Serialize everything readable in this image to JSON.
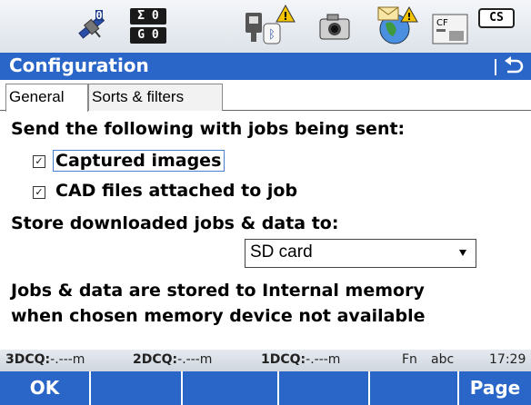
{
  "status_bar": {
    "satellite_count": "0",
    "sigma_value": "0",
    "g_value": "0",
    "sigma_label": "Σ",
    "g_label": "G",
    "cf_label": "CF",
    "cs_label": "CS",
    "icons": [
      "satellite-icon",
      "sensor-bluetooth-warning-icon",
      "camera-icon",
      "globe-mail-warning-icon",
      "cf-card-icon",
      "cs-controller-icon"
    ]
  },
  "title_bar": {
    "title": "Configuration",
    "color": "#2a65c8"
  },
  "tabs": [
    {
      "label": "General",
      "active": true
    },
    {
      "label": "Sorts & filters",
      "active": false
    }
  ],
  "content": {
    "send_heading": "Send the following with jobs being sent:",
    "checkboxes": [
      {
        "label": "Captured images",
        "checked": true,
        "focused": true
      },
      {
        "label": "CAD files attached to job",
        "checked": true,
        "focused": false
      }
    ],
    "store_heading": "Store downloaded jobs & data to:",
    "storage_select": {
      "value": "SD card"
    },
    "note_line1": "Jobs & data are stored to Internal memory",
    "note_line2": "when chosen memory device not available"
  },
  "info_bar": {
    "dcq3_label": "3DCQ:",
    "dcq3_value": "-.---m",
    "dcq2_label": "2DCQ:",
    "dcq2_value": "-.---m",
    "dcq1_label": "1DCQ:",
    "dcq1_value": "-.---m",
    "fn_label": "Fn",
    "input_mode": "abc",
    "time": "17:29"
  },
  "softkeys": {
    "f1": "OK",
    "f2": "",
    "f3": "",
    "f4": "",
    "f5": "",
    "f6": "Page"
  }
}
